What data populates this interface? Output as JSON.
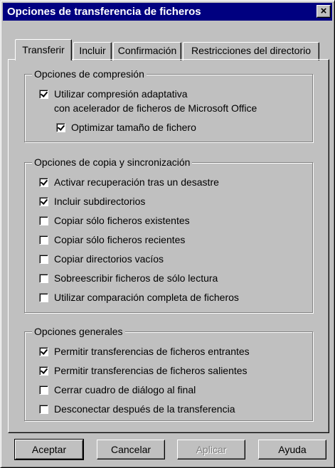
{
  "window": {
    "title": "Opciones de transferencia de ficheros",
    "close_label": "×"
  },
  "tabs": [
    {
      "label": "Transferir",
      "active": true
    },
    {
      "label": "Incluir",
      "active": false
    },
    {
      "label": "Confirmación",
      "active": false
    },
    {
      "label": "Restricciones del directorio",
      "active": false
    }
  ],
  "compression": {
    "legend": "Opciones de compresión",
    "adaptive": {
      "label": "Utilizar compresión adaptativa",
      "checked": true
    },
    "adaptive_sub": "con acelerador de ficheros de Microsoft Office",
    "optimize": {
      "label": "Optimizar tamaño de fichero",
      "checked": true
    }
  },
  "copy_sync": {
    "legend": "Opciones de copia y sincronización",
    "options": [
      {
        "label": "Activar recuperación tras un desastre",
        "checked": true
      },
      {
        "label": "Incluir subdirectorios",
        "checked": true
      },
      {
        "label": "Copiar sólo ficheros existentes",
        "checked": false
      },
      {
        "label": "Copiar sólo ficheros recientes",
        "checked": false
      },
      {
        "label": "Copiar directorios vacíos",
        "checked": false
      },
      {
        "label": "Sobreescribir ficheros de sólo lectura",
        "checked": false
      },
      {
        "label": "Utilizar comparación completa de ficheros",
        "checked": false
      }
    ]
  },
  "general": {
    "legend": "Opciones generales",
    "options": [
      {
        "label": "Permitir transferencias de ficheros entrantes",
        "checked": true
      },
      {
        "label": "Permitir transferencias de ficheros salientes",
        "checked": true
      },
      {
        "label": "Cerrar cuadro de diálogo al final",
        "checked": false
      },
      {
        "label": "Desconectar después de la transferencia",
        "checked": false
      }
    ]
  },
  "buttons": {
    "accept": "Aceptar",
    "cancel": "Cancelar",
    "apply": "Aplicar",
    "help": "Ayuda"
  }
}
